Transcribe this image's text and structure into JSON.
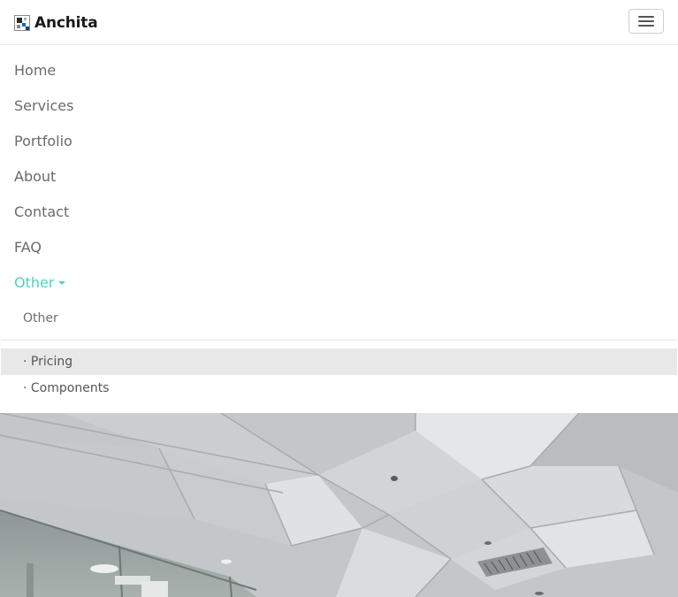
{
  "brand": {
    "name": "Anchita",
    "logo_icon": "brand-logo-icon"
  },
  "toggler": {
    "icon": "hamburger-menu-icon"
  },
  "nav": {
    "items": [
      {
        "label": "Home"
      },
      {
        "label": "Services"
      },
      {
        "label": "Portfolio"
      },
      {
        "label": "About"
      },
      {
        "label": "Contact"
      },
      {
        "label": "FAQ"
      },
      {
        "label": "Other",
        "active": true,
        "icon": "caret-down-icon"
      }
    ]
  },
  "dropdown": {
    "header": "Other",
    "items": [
      {
        "label": "· Pricing",
        "highlighted": true
      },
      {
        "label": "· Components"
      }
    ]
  },
  "colors": {
    "accent": "#4fd1c5",
    "text_muted": "#6b6b6b",
    "hover_bg": "#e8e8e8"
  },
  "hero": {
    "image": "office-ceiling-photo"
  }
}
